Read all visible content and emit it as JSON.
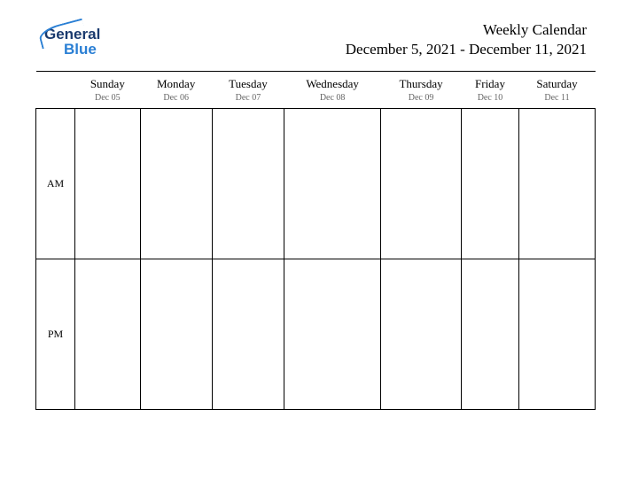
{
  "logo": {
    "line1": "General",
    "line2": "Blue"
  },
  "header": {
    "title": "Weekly Calendar",
    "date_range": "December 5, 2021 - December 11, 2021"
  },
  "days": [
    {
      "name": "Sunday",
      "date": "Dec 05"
    },
    {
      "name": "Monday",
      "date": "Dec 06"
    },
    {
      "name": "Tuesday",
      "date": "Dec 07"
    },
    {
      "name": "Wednesday",
      "date": "Dec 08"
    },
    {
      "name": "Thursday",
      "date": "Dec 09"
    },
    {
      "name": "Friday",
      "date": "Dec 10"
    },
    {
      "name": "Saturday",
      "date": "Dec 11"
    }
  ],
  "periods": {
    "am": "AM",
    "pm": "PM"
  }
}
